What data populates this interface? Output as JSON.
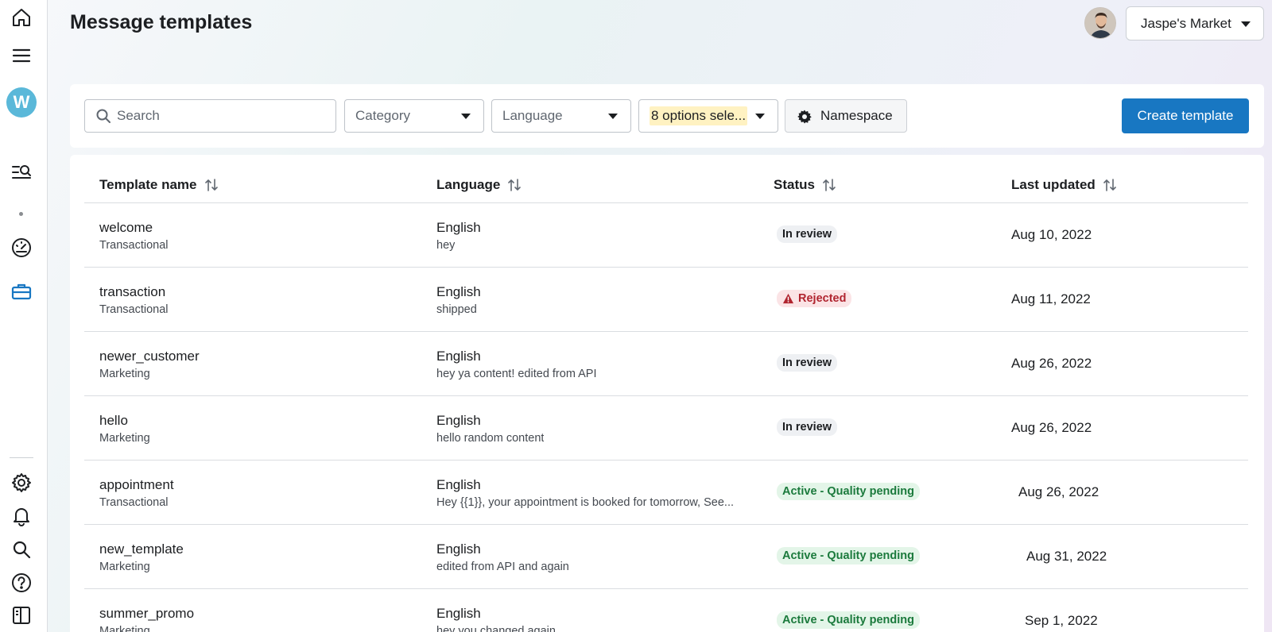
{
  "header": {
    "title": "Message templates",
    "account_name": "Jaspe's Market"
  },
  "rail": {
    "workspace_initial": "W"
  },
  "filters": {
    "search_placeholder": "Search",
    "category_label": "Category",
    "language_label": "Language",
    "status_label": "8 options sele...",
    "namespace_label": "Namespace",
    "create_label": "Create template"
  },
  "table": {
    "columns": {
      "name": "Template name",
      "language": "Language",
      "status": "Status",
      "updated": "Last updated"
    },
    "rows": [
      {
        "name": "welcome",
        "category": "Transactional",
        "language": "English",
        "preview": "hey",
        "status": "In review",
        "status_kind": "review",
        "updated": "Aug 10, 2022"
      },
      {
        "name": "transaction",
        "category": "Transactional",
        "language": "English",
        "preview": "shipped",
        "status": "Rejected",
        "status_kind": "rejected",
        "updated": "Aug 11, 2022"
      },
      {
        "name": "newer_customer",
        "category": "Marketing",
        "language": "English",
        "preview": "hey ya content! edited from API",
        "status": "In review",
        "status_kind": "review",
        "updated": "Aug 26, 2022"
      },
      {
        "name": "hello",
        "category": "Marketing",
        "language": "English",
        "preview": "hello random content",
        "status": "In review",
        "status_kind": "review",
        "updated": "Aug 26, 2022"
      },
      {
        "name": "appointment",
        "category": "Transactional",
        "language": "English",
        "preview": "Hey {{1}}, your appointment is booked for tomorrow, See...",
        "status": "Active - Quality pending",
        "status_kind": "active",
        "updated": "Aug 26, 2022"
      },
      {
        "name": "new_template",
        "category": "Marketing",
        "language": "English",
        "preview": "edited from API and again",
        "status": "Active - Quality pending",
        "status_kind": "active",
        "updated": "Aug 31, 2022"
      },
      {
        "name": "summer_promo",
        "category": "Marketing",
        "language": "English",
        "preview": "hey you changed again",
        "status": "Active - Quality pending",
        "status_kind": "active",
        "updated": "Sep 1, 2022"
      }
    ]
  }
}
